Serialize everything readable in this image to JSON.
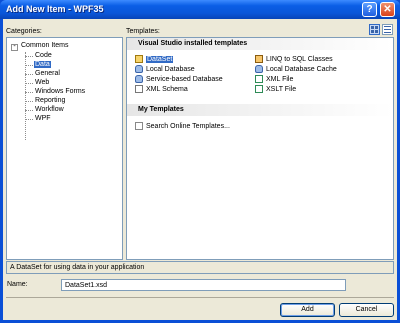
{
  "window": {
    "title": "Add New Item - WPF35"
  },
  "categories": {
    "label": "Categories:",
    "root": "Common Items",
    "children": [
      "Code",
      "Data",
      "General",
      "Web",
      "Windows Forms",
      "Reporting",
      "Workflow",
      "WPF"
    ],
    "selected": "Data"
  },
  "templates": {
    "label": "Templates:",
    "installed_heading": "Visual Studio installed templates",
    "installed_left": [
      "DataSet",
      "Local Database",
      "Service-based Database",
      "XML Schema"
    ],
    "installed_right": [
      "LINQ to SQL Classes",
      "Local Database Cache",
      "XML File",
      "XSLT File"
    ],
    "my_heading": "My Templates",
    "my_items": [
      "Search Online Templates..."
    ],
    "selected": "DataSet"
  },
  "description": "A DataSet for using data in your application",
  "name_field": {
    "label": "Name:",
    "value": "DataSet1.xsd"
  },
  "buttons": {
    "add": "Add",
    "cancel": "Cancel"
  },
  "icons": {
    "help": "help-icon",
    "close": "close-icon",
    "large_icons_view": "large-icons-view-icon",
    "small_icons_view": "small-icons-view-icon"
  },
  "colors": {
    "title_bar": "#0a56d8",
    "selection": "#316ac5",
    "dialog_bg": "#ece9d8"
  }
}
